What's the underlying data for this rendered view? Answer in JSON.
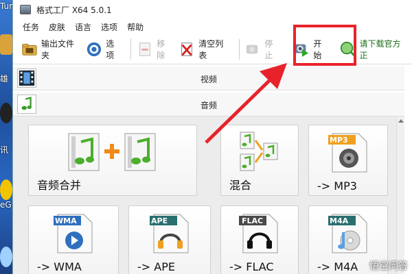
{
  "desktop": {
    "labels": [
      "Tur",
      "雄",
      "讯",
      "eG"
    ]
  },
  "window": {
    "title": "格式工厂 X64 5.0.1"
  },
  "menu": {
    "items": [
      "任务",
      "皮肤",
      "语言",
      "选项",
      "帮助"
    ]
  },
  "toolbar": {
    "output_folder": "输出文件夹",
    "options": "选项",
    "remove": "移除",
    "clear_list": "清空列表",
    "stop": "停止",
    "start": "开始",
    "download": "请下载官方正"
  },
  "categories": {
    "video": "视频",
    "audio": "音频"
  },
  "tiles": [
    {
      "label": "音频合并",
      "icon": "audio-merge-icon"
    },
    {
      "label": "混合",
      "icon": "mix-icon"
    },
    {
      "label": "-> MP3",
      "icon": "mp3-icon",
      "badge": "MP3"
    },
    {
      "label": "-> WMA",
      "icon": "wma-icon",
      "badge": "WMA"
    },
    {
      "label": "-> APE",
      "icon": "ape-icon",
      "badge": "APE"
    },
    {
      "label": "-> FLAC",
      "icon": "flac-icon",
      "badge": "FLAC"
    },
    {
      "label": "-> M4A",
      "icon": "m4a-icon",
      "badge": "M4A"
    }
  ],
  "watermark": "悟空问答",
  "colors": {
    "highlight": "#e8222a",
    "start_green": "#2aa52a",
    "badge_orange": "#f0a020",
    "badge_blue": "#2f6fbf",
    "badge_teal": "#2a6f6f"
  }
}
